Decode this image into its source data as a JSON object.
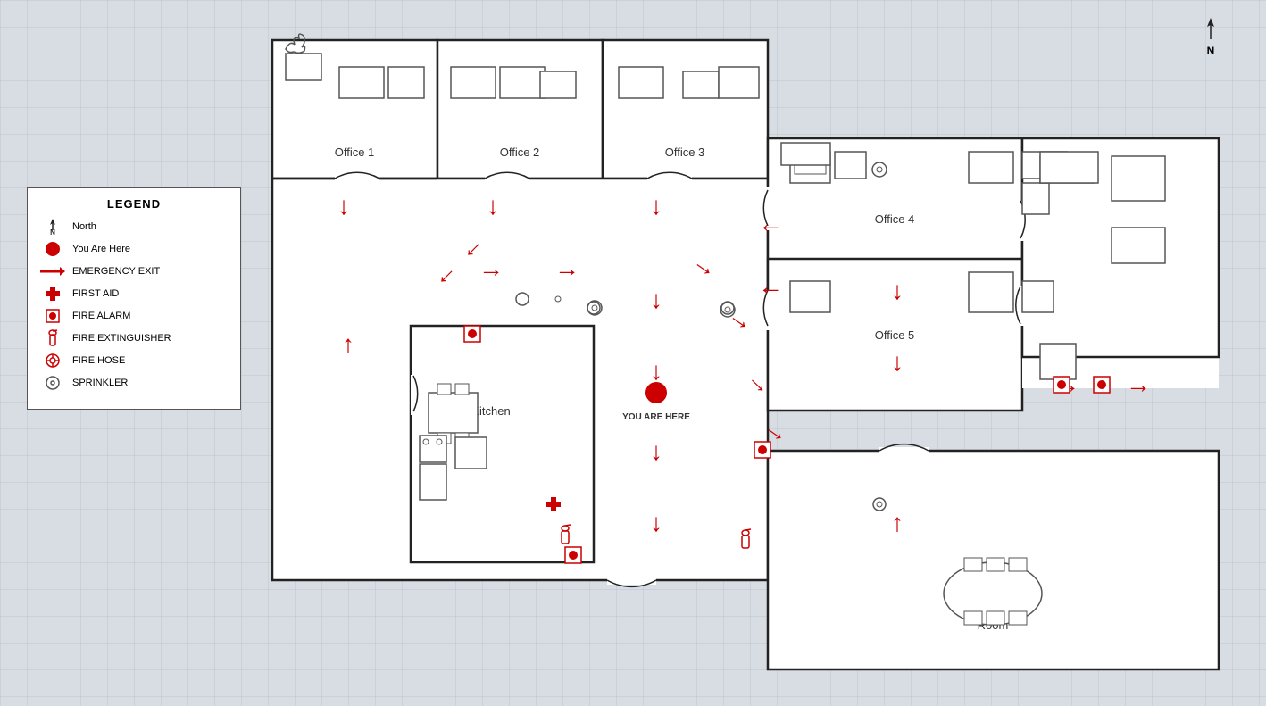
{
  "legend": {
    "title": "LEGEND",
    "items": [
      {
        "icon": "north",
        "label": "North"
      },
      {
        "icon": "you-are-here",
        "label": "You Are Here"
      },
      {
        "icon": "emergency-exit",
        "label": "EMERGENCY EXIT"
      },
      {
        "icon": "first-aid",
        "label": "FIRST AID"
      },
      {
        "icon": "fire-alarm",
        "label": "FIRE ALARM"
      },
      {
        "icon": "fire-extinguisher",
        "label": "FIRE EXTINGUISHER"
      },
      {
        "icon": "fire-hose",
        "label": "FIRE HOSE"
      },
      {
        "icon": "sprinkler",
        "label": "SPRINKLER"
      }
    ]
  },
  "rooms": [
    {
      "id": "office1",
      "label": "Office 1"
    },
    {
      "id": "office2",
      "label": "Office 2"
    },
    {
      "id": "office3",
      "label": "Office 3"
    },
    {
      "id": "office4",
      "label": "Office 4"
    },
    {
      "id": "office5",
      "label": "Office 5"
    },
    {
      "id": "kitchen",
      "label": "Kitchen"
    },
    {
      "id": "room",
      "label": "Room"
    }
  ],
  "you_are_here": "YOU ARE HERE",
  "north_label": "N",
  "colors": {
    "red": "#cc0000",
    "wall": "#222222",
    "furniture": "#555555",
    "background": "#d8dde3"
  }
}
